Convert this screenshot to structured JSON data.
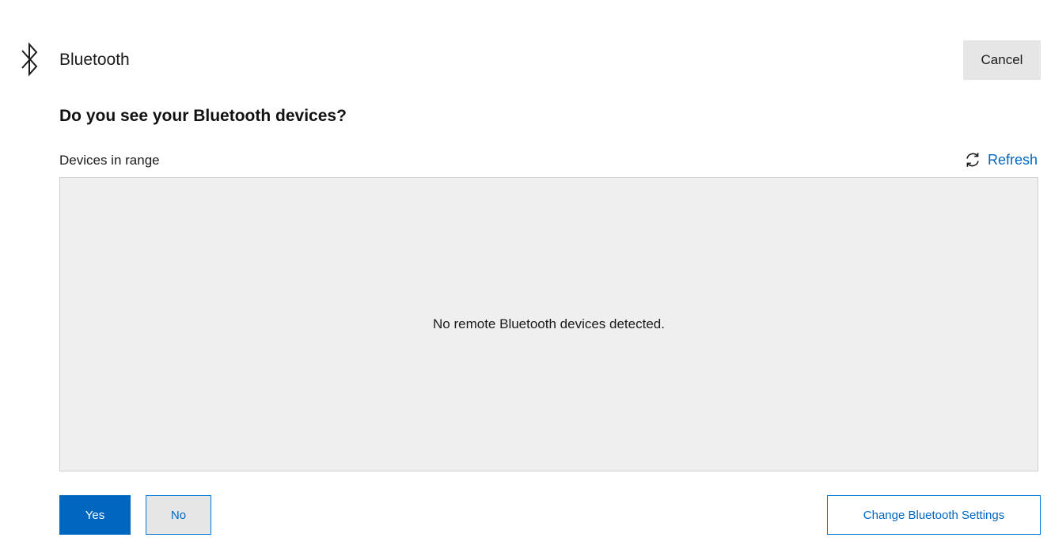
{
  "header": {
    "icon": "bluetooth-icon",
    "title": "Bluetooth",
    "cancel_label": "Cancel"
  },
  "main": {
    "question": "Do you see your Bluetooth devices?",
    "devices_label": "Devices in range",
    "refresh": {
      "icon": "refresh-icon",
      "label": "Refresh"
    },
    "empty_message": "No remote Bluetooth devices detected."
  },
  "footer": {
    "yes_label": "Yes",
    "no_label": "No",
    "settings_label": "Change Bluetooth Settings"
  },
  "colors": {
    "accent": "#0067c0",
    "panel_background": "#efefef",
    "secondary_button": "#e6e6e6"
  }
}
